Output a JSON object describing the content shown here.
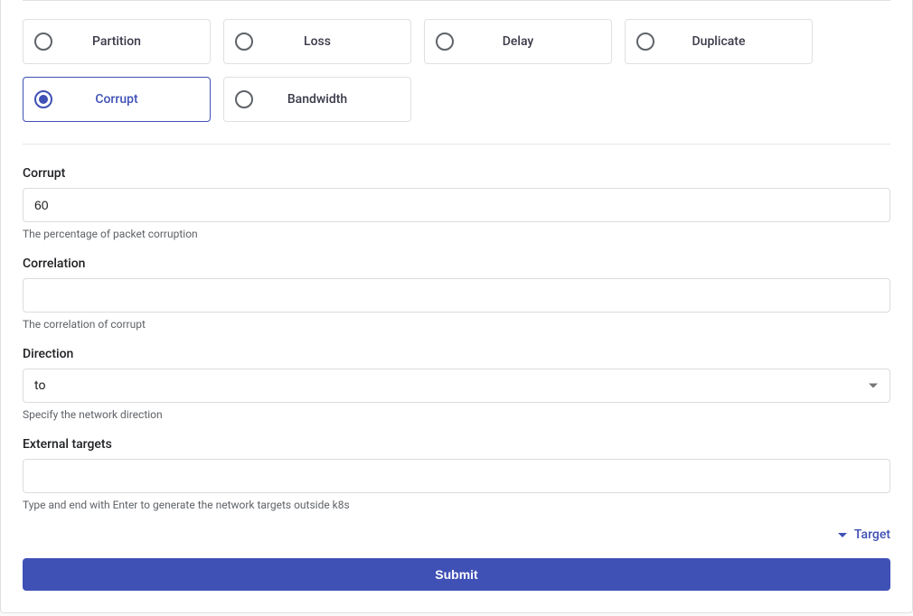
{
  "action_options": [
    {
      "key": "partition",
      "label": "Partition",
      "selected": false
    },
    {
      "key": "loss",
      "label": "Loss",
      "selected": false
    },
    {
      "key": "delay",
      "label": "Delay",
      "selected": false
    },
    {
      "key": "duplicate",
      "label": "Duplicate",
      "selected": false
    },
    {
      "key": "corrupt",
      "label": "Corrupt",
      "selected": true
    },
    {
      "key": "bandwidth",
      "label": "Bandwidth",
      "selected": false
    }
  ],
  "fields": {
    "corrupt": {
      "label": "Corrupt",
      "value": "60",
      "helper": "The percentage of packet corruption"
    },
    "correlation": {
      "label": "Correlation",
      "value": "",
      "helper": "The correlation of corrupt"
    },
    "direction": {
      "label": "Direction",
      "value": "to",
      "helper": "Specify the network direction"
    },
    "external_targets": {
      "label": "External targets",
      "value": "",
      "helper": "Type and end with Enter to generate the network targets outside k8s"
    }
  },
  "target_toggle_label": "Target",
  "submit_label": "Submit"
}
